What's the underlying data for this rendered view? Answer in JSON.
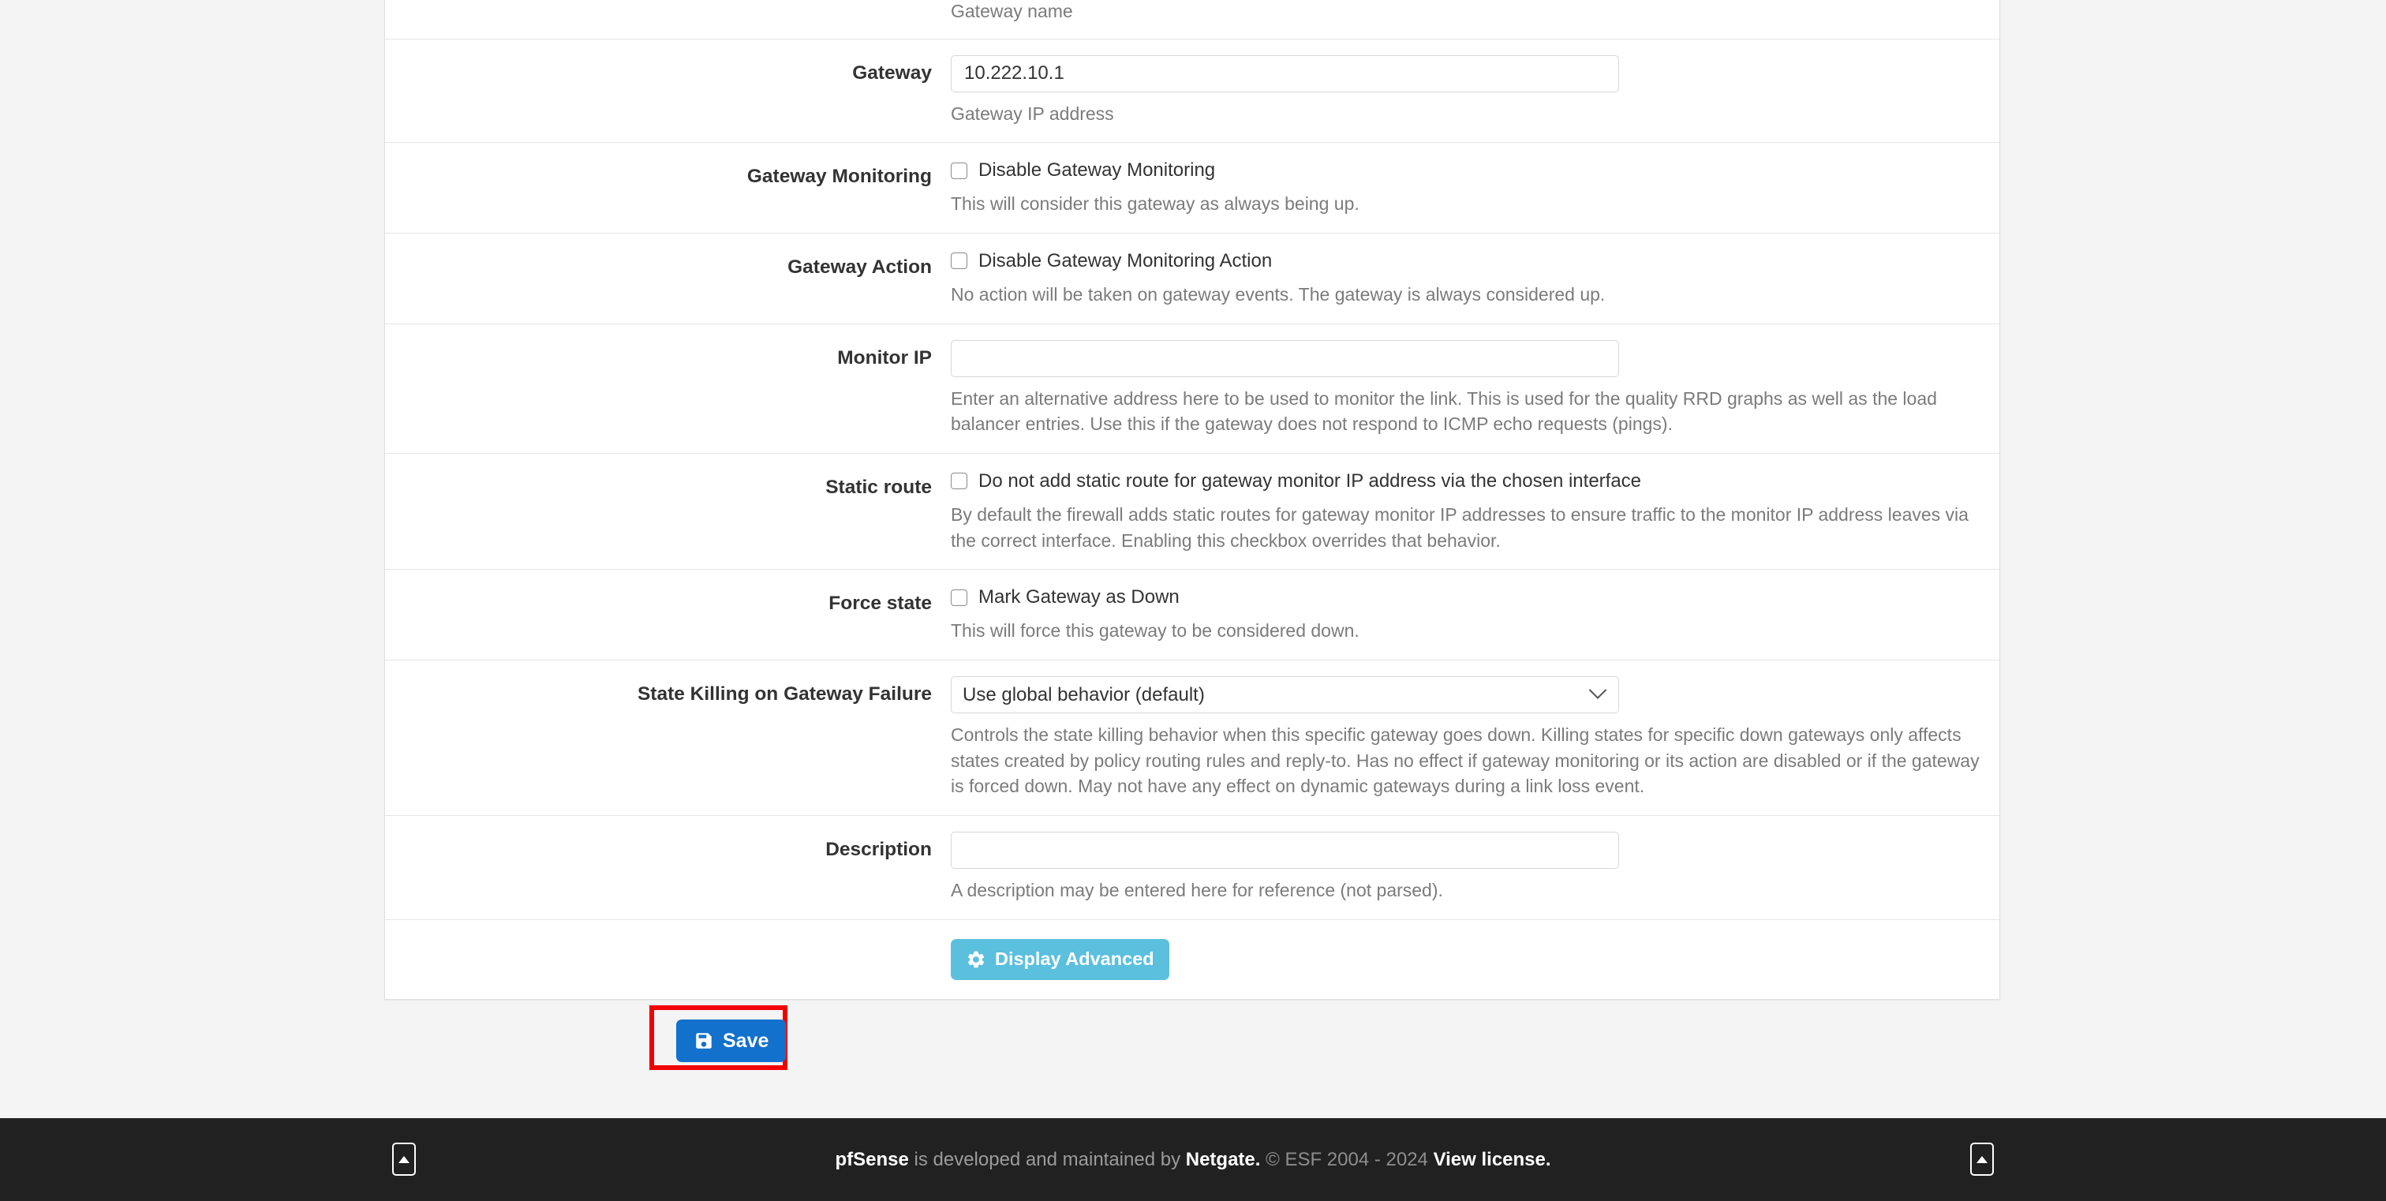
{
  "form": {
    "rows": [
      {
        "id": "gateway-name",
        "label": "",
        "help": "Gateway name"
      },
      {
        "id": "gateway",
        "label": "Gateway",
        "value": "10.222.10.1",
        "placeholder": "",
        "help": "Gateway IP address"
      },
      {
        "id": "gateway-monitoring",
        "label": "Gateway Monitoring",
        "checkbox_label": "Disable Gateway Monitoring",
        "checked": false,
        "help": "This will consider this gateway as always being up."
      },
      {
        "id": "gateway-action",
        "label": "Gateway Action",
        "checkbox_label": "Disable Gateway Monitoring Action",
        "checked": false,
        "help": "No action will be taken on gateway events. The gateway is always considered up."
      },
      {
        "id": "monitor-ip",
        "label": "Monitor IP",
        "value": "",
        "placeholder": "",
        "help": "Enter an alternative address here to be used to monitor the link. This is used for the quality RRD graphs as well as the load balancer entries. Use this if the gateway does not respond to ICMP echo requests (pings)."
      },
      {
        "id": "static-route",
        "label": "Static route",
        "checkbox_label": "Do not add static route for gateway monitor IP address via the chosen interface",
        "checked": false,
        "help": "By default the firewall adds static routes for gateway monitor IP addresses to ensure traffic to the monitor IP address leaves via the correct interface. Enabling this checkbox overrides that behavior."
      },
      {
        "id": "force-state",
        "label": "Force state",
        "checkbox_label": "Mark Gateway as Down",
        "checked": false,
        "help": "This will force this gateway to be considered down."
      },
      {
        "id": "state-killing",
        "label": "State Killing on Gateway Failure",
        "selected": "Use global behavior (default)",
        "options": [
          "Use global behavior (default)"
        ],
        "help": "Controls the state killing behavior when this specific gateway goes down. Killing states for specific down gateways only affects states created by policy routing rules and reply-to. Has no effect if gateway monitoring or its action are disabled or if the gateway is forced down. May not have any effect on dynamic gateways during a link loss event."
      },
      {
        "id": "description",
        "label": "Description",
        "value": "",
        "placeholder": "",
        "help": "A description may be entered here for reference (not parsed)."
      }
    ],
    "display_advanced_label": "Display Advanced",
    "save_label": "Save"
  },
  "footer": {
    "brand": "pfSense",
    "middle": " is developed and maintained by ",
    "company": "Netgate.",
    "copyright": " © ESF 2004 - 2024 ",
    "license": "View license."
  },
  "colors": {
    "info_button": "#5bc0de",
    "primary_button": "#1271cd",
    "highlight_box": "#f20000",
    "footer_bg": "#212121",
    "page_bg": "#f4f4f4"
  }
}
